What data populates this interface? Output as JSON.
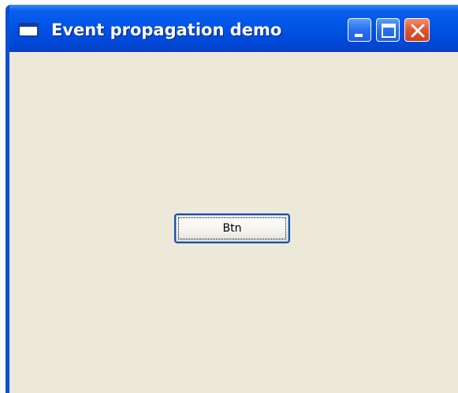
{
  "window": {
    "title": "Event propagation demo",
    "icon": "app-window-icon",
    "controls": {
      "minimize_icon": "minimize-icon",
      "maximize_icon": "maximize-icon",
      "close_icon": "close-icon"
    }
  },
  "client": {
    "button_label": "Btn"
  },
  "colors": {
    "titlebar": "#0055e5",
    "frame": "#0a4fd8",
    "client_bg": "#ece9d8",
    "close_button": "#e2532e"
  }
}
